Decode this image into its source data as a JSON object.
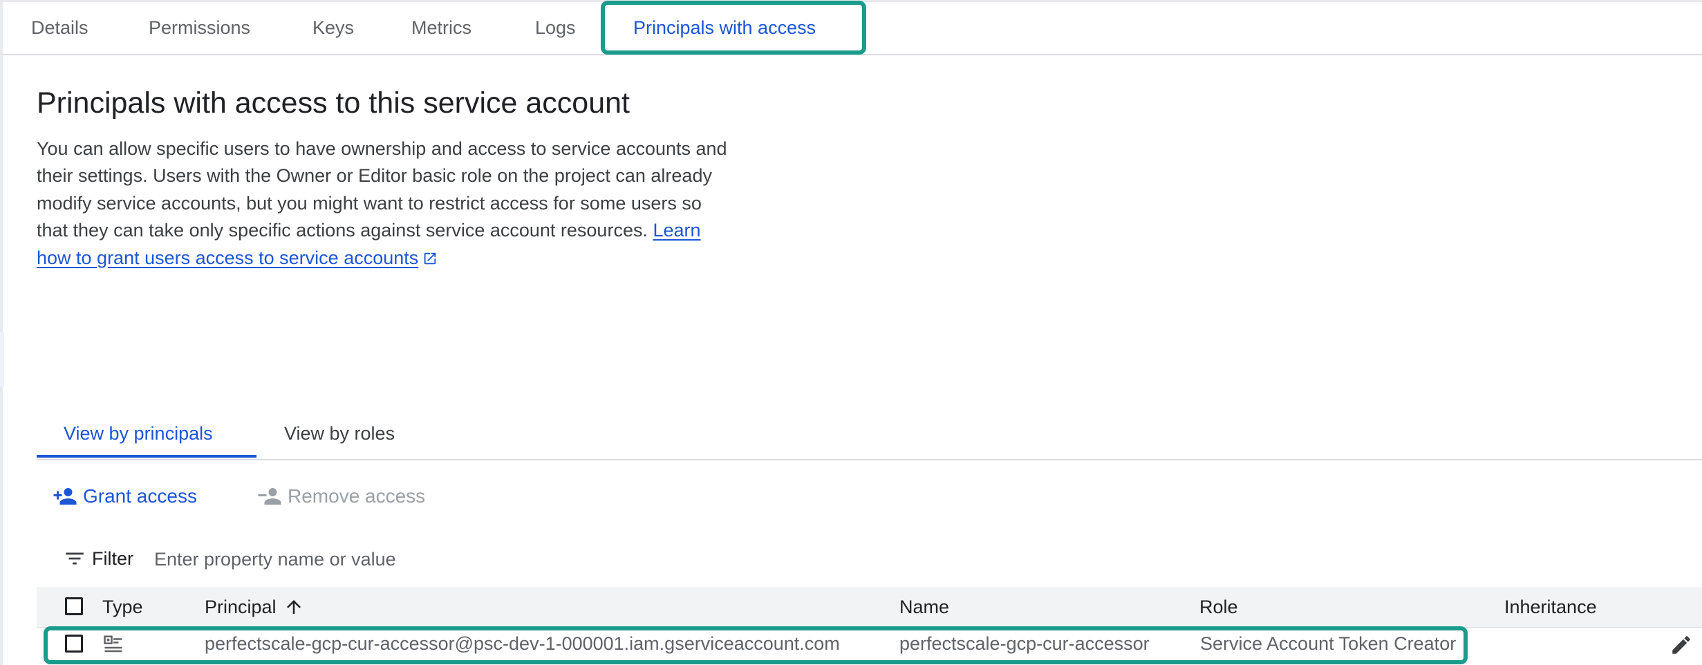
{
  "tabs": [
    "Details",
    "Permissions",
    "Keys",
    "Metrics",
    "Logs",
    "Principals with access"
  ],
  "active_tab": "Principals with access",
  "page": {
    "title": "Principals with access to this service account",
    "description": "You can allow specific users to have ownership and access to service accounts and their settings. Users with the Owner or Editor basic role on the project can already modify service accounts, but you might want to restrict access for some users so that they can take only specific actions against service account resources.",
    "learn_link": "Learn how to grant users access to service accounts"
  },
  "view_tabs": [
    "View by principals",
    "View by roles"
  ],
  "active_view_tab": "View by principals",
  "actions": {
    "grant": "Grant access",
    "remove": "Remove access"
  },
  "filter": {
    "label": "Filter",
    "placeholder": "Enter property name or value"
  },
  "table": {
    "columns": [
      "Type",
      "Principal",
      "Name",
      "Role",
      "Inheritance"
    ],
    "sort_column": "Principal",
    "sort_direction": "ascending",
    "rows": [
      {
        "type_icon": "service-account-icon",
        "principal": "perfectscale-gcp-cur-accessor@psc-dev-1-000001.iam.gserviceaccount.com",
        "name": "perfectscale-gcp-cur-accessor",
        "role": "Service Account Token Creator",
        "inheritance": ""
      }
    ]
  },
  "colors": {
    "accent": "#1a56d6",
    "highlight": "#1a9c8c",
    "disabled": "#9aa0a6"
  }
}
